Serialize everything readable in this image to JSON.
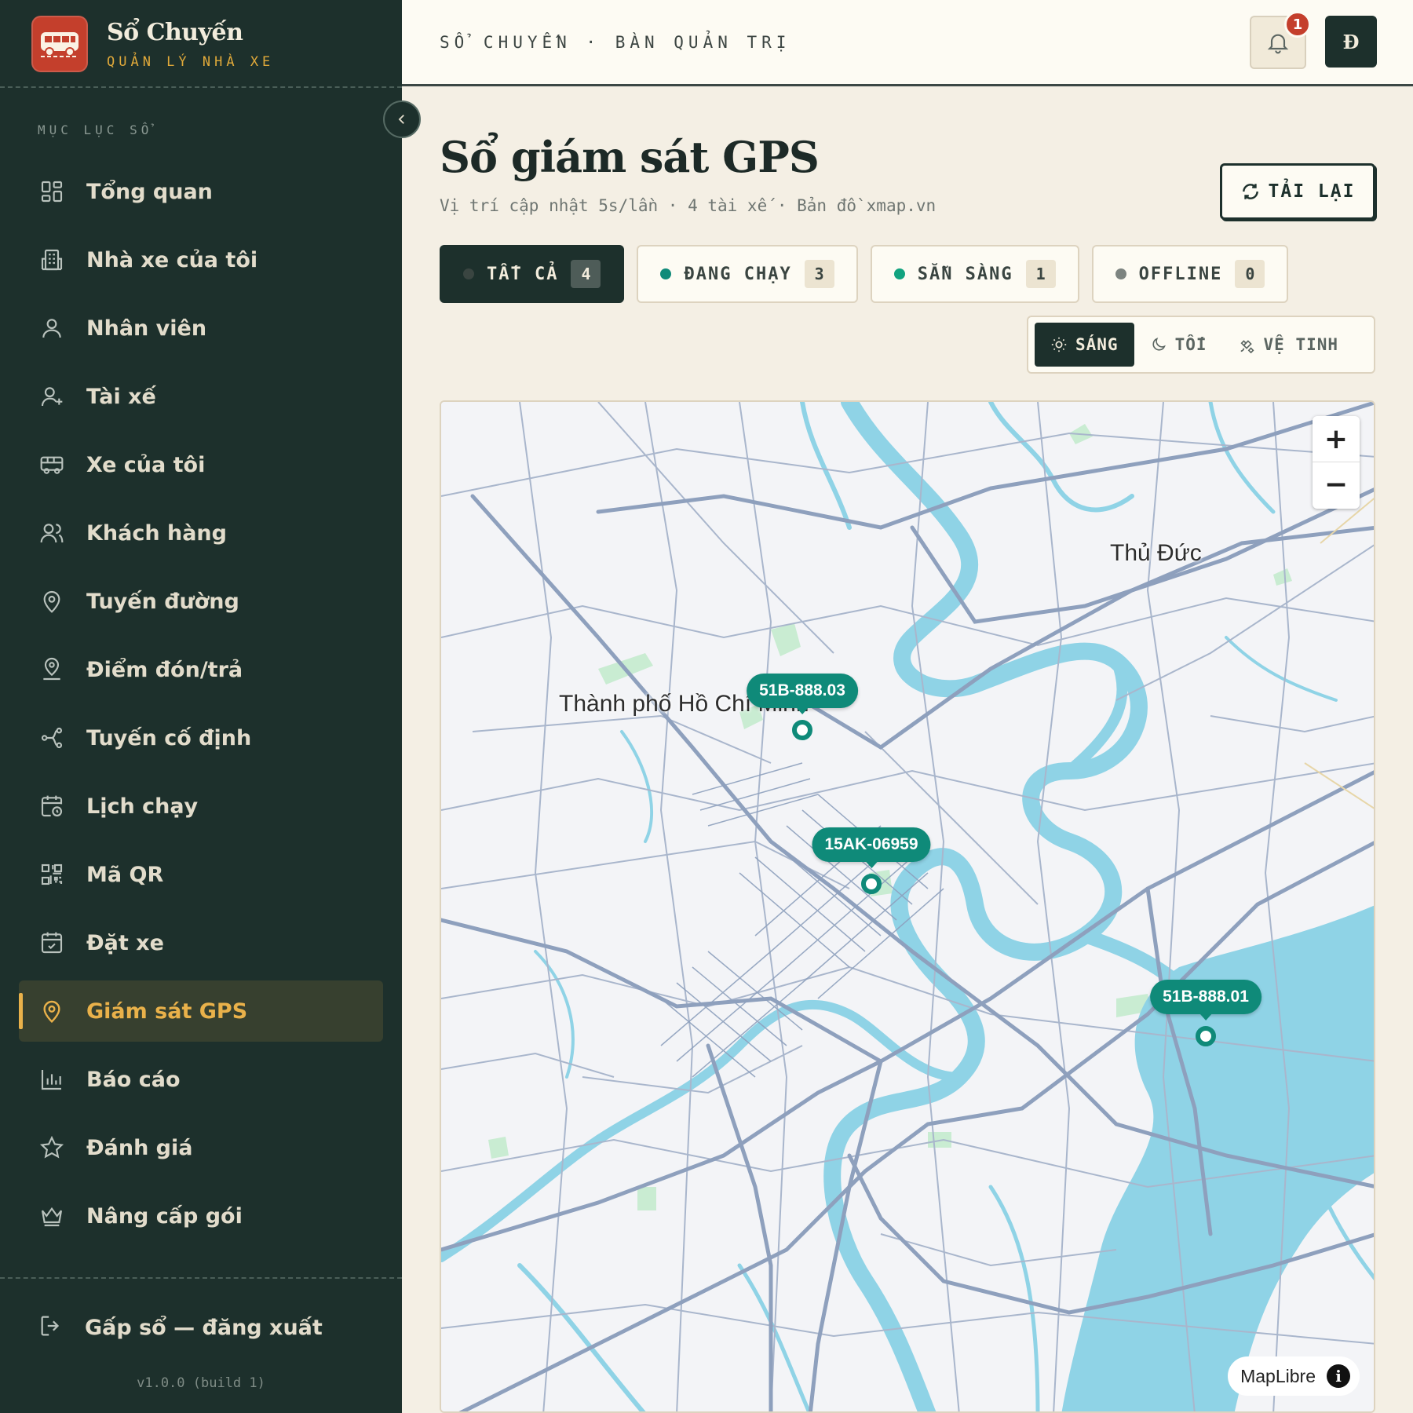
{
  "brand": {
    "title": "Sổ Chuyến",
    "subtitle": "QUẢN LÝ NHÀ XE"
  },
  "sidebar": {
    "heading": "MỤC LỤC SỔ",
    "items": [
      {
        "label": "Tổng quan",
        "icon": "dashboard-icon"
      },
      {
        "label": "Nhà xe của tôi",
        "icon": "building-icon"
      },
      {
        "label": "Nhân viên",
        "icon": "user-icon"
      },
      {
        "label": "Tài xế",
        "icon": "user-plus-icon"
      },
      {
        "label": "Xe của tôi",
        "icon": "bus-icon"
      },
      {
        "label": "Khách hàng",
        "icon": "users-icon"
      },
      {
        "label": "Tuyến đường",
        "icon": "map-pin-icon"
      },
      {
        "label": "Điểm đón/trả",
        "icon": "pin-person-icon"
      },
      {
        "label": "Tuyến cố định",
        "icon": "route-icon"
      },
      {
        "label": "Lịch chạy",
        "icon": "calendar-clock-icon"
      },
      {
        "label": "Mã QR",
        "icon": "qr-icon"
      },
      {
        "label": "Đặt xe",
        "icon": "calendar-check-icon"
      },
      {
        "label": "Giám sát GPS",
        "icon": "map-pin-icon",
        "active": true
      },
      {
        "label": "Báo cáo",
        "icon": "bar-chart-icon"
      },
      {
        "label": "Đánh giá",
        "icon": "star-icon"
      },
      {
        "label": "Nâng cấp gói",
        "icon": "crown-icon"
      }
    ],
    "logout_label": "Gấp sổ — đăng xuất",
    "version": "v1.0.0 (build 1)"
  },
  "topbar": {
    "breadcrumb": "SỔ CHUYẾN · BÀN QUẢN TRỊ",
    "notification_count": "1",
    "avatar_initial": "Đ"
  },
  "page": {
    "title": "Sổ giám sát GPS",
    "subtitle": "Vị trí cập nhật 5s/lần · 4 tài xế · Bản đồ xmap.vn",
    "reload_label": "TẢI LẠI"
  },
  "filters": [
    {
      "label": "TẤT CẢ",
      "count": "4",
      "color": "#3a4541",
      "active": true
    },
    {
      "label": "ĐANG CHẠY",
      "count": "3",
      "color": "#0f8a79"
    },
    {
      "label": "SẴN SÀNG",
      "count": "1",
      "color": "#12a37f"
    },
    {
      "label": "OFFLINE",
      "count": "0",
      "color": "#7d8480"
    }
  ],
  "map_styles": [
    {
      "label": "SÁNG",
      "icon": "sun-icon",
      "active": true
    },
    {
      "label": "TỐI",
      "icon": "moon-icon"
    },
    {
      "label": "VỆ TINH",
      "icon": "satellite-icon"
    }
  ],
  "map": {
    "labels": {
      "city": "Thành phố Hồ Chí Minh",
      "district": "Thủ Đức"
    },
    "vehicles": [
      {
        "plate": "51B-888.03"
      },
      {
        "plate": "15AK-06959"
      },
      {
        "plate": "51B-888.01"
      }
    ],
    "zoom_in": "+",
    "zoom_out": "−",
    "attribution": "MapLibre",
    "info": "i"
  },
  "colors": {
    "sidebar_bg": "#1d302c",
    "accent": "#e9b14a",
    "brand_red": "#c43f2c",
    "marker": "#0f8a79",
    "water": "#8fd3e6",
    "road": "#8ea0bd"
  }
}
